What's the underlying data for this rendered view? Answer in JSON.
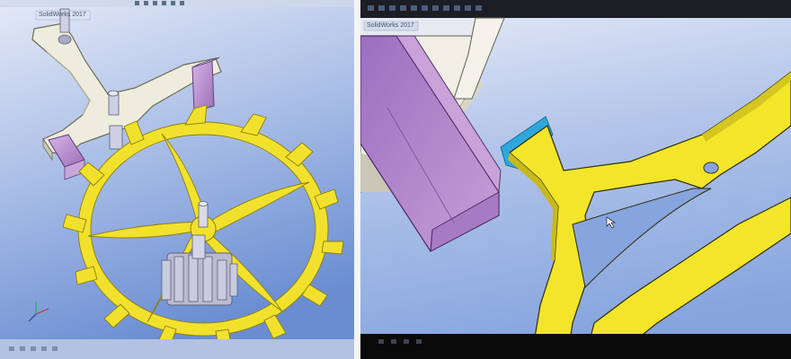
{
  "app": {
    "name": "SolidWorks",
    "left_window_title": "SolidWorks 2017",
    "right_window_title": "SolidWorks 2017"
  },
  "colors": {
    "viewport_top": "#dfe6f6",
    "viewport_bottom": "#6d8fd0",
    "escape_wheel": "#f2e12c",
    "escape_wheel_edge": "#8a7f10",
    "pallet_fork": "#eeeede",
    "pallet_jewel": "#b78ccc",
    "pinion": "#b9bbd0",
    "selection_highlight": "#2fa7dd",
    "monitor_bezel": "#0a0a0a"
  },
  "icons": [
    "toolbar-icons",
    "view-orientation-icon",
    "mouse-cursor-icon"
  ]
}
